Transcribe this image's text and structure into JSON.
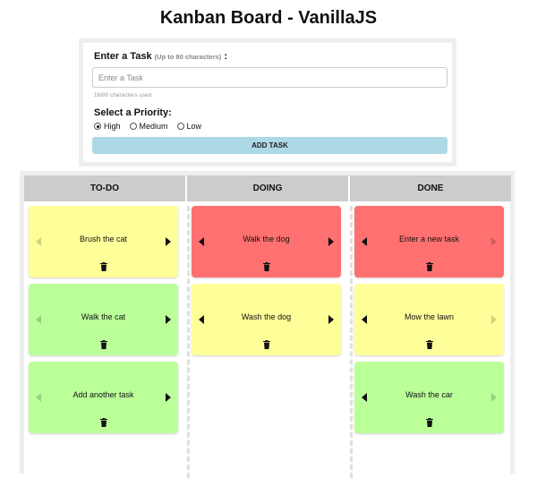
{
  "page": {
    "title": "Kanban Board - VanillaJS"
  },
  "form": {
    "task_label": "Enter a Task",
    "task_hint": "(Up to 80 characters)",
    "task_colon": ":",
    "task_placeholder": "Enter a Task",
    "task_value": "",
    "chars_used": "16/80 characters used",
    "priority_label": "Select a Priority:",
    "priorities": [
      {
        "label": "High",
        "checked": true
      },
      {
        "label": "Medium",
        "checked": false
      },
      {
        "label": "Low",
        "checked": false
      }
    ],
    "add_button": "ADD TASK"
  },
  "board": {
    "columns": [
      {
        "title": "TO-DO",
        "cards": [
          {
            "text": "Brush the cat",
            "color": "yellow",
            "left_enabled": false,
            "right_enabled": true
          },
          {
            "text": "Walk the cat",
            "color": "green",
            "left_enabled": false,
            "right_enabled": true
          },
          {
            "text": "Add another task",
            "color": "green",
            "left_enabled": false,
            "right_enabled": true
          }
        ]
      },
      {
        "title": "DOING",
        "cards": [
          {
            "text": "Walk the dog",
            "color": "red",
            "left_enabled": true,
            "right_enabled": true
          },
          {
            "text": "Wash the dog",
            "color": "yellow",
            "left_enabled": true,
            "right_enabled": true
          }
        ]
      },
      {
        "title": "DONE",
        "cards": [
          {
            "text": "Enter a new task",
            "color": "red",
            "left_enabled": true,
            "right_enabled": false
          },
          {
            "text": "Mow the lawn",
            "color": "yellow",
            "left_enabled": true,
            "right_enabled": false
          },
          {
            "text": "Wash the car",
            "color": "green",
            "left_enabled": true,
            "right_enabled": false
          }
        ]
      }
    ]
  },
  "colors": {
    "high": "#ff7070",
    "medium": "#ffff99",
    "low": "#bbff99",
    "button": "#add8e6",
    "header": "#cccccc"
  },
  "icons": {
    "move_left": "caret-left-icon",
    "move_right": "caret-right-icon",
    "delete": "trash-icon"
  }
}
